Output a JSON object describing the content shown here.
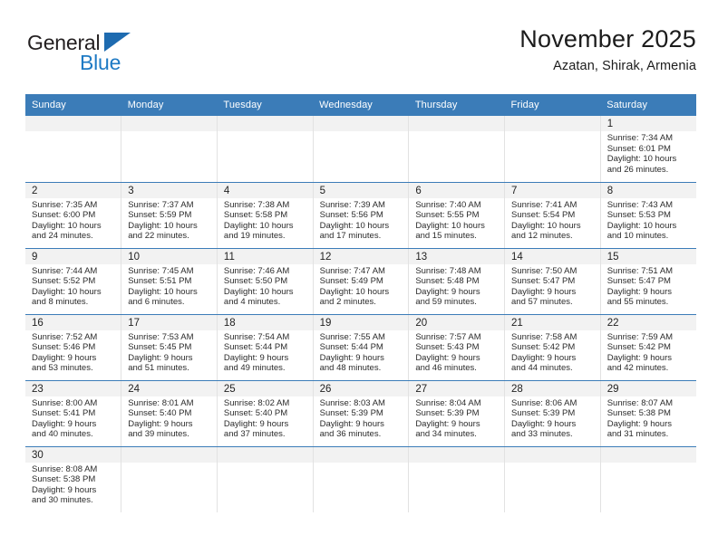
{
  "brand": {
    "name_part1": "General",
    "name_part2": "Blue",
    "triangle_color": "#1e6bb0",
    "blue_color": "#1e7ac4"
  },
  "header": {
    "title": "November 2025",
    "subtitle": "Azatan, Shirak, Armenia"
  },
  "theme": {
    "header_blue": "#3b7cb8",
    "daynum_bg": "#f2f2f2",
    "row_divider": "#3b7cb8",
    "cell_divider": "#e2e2e2"
  },
  "weekdays": [
    "Sunday",
    "Monday",
    "Tuesday",
    "Wednesday",
    "Thursday",
    "Friday",
    "Saturday"
  ],
  "labels": {
    "sunrise": "Sunrise:",
    "sunset": "Sunset:",
    "daylight": "Daylight:"
  },
  "weeks": [
    [
      {
        "day": "",
        "empty": true
      },
      {
        "day": "",
        "empty": true
      },
      {
        "day": "",
        "empty": true
      },
      {
        "day": "",
        "empty": true
      },
      {
        "day": "",
        "empty": true
      },
      {
        "day": "",
        "empty": true
      },
      {
        "day": "1",
        "sunrise": "Sunrise: 7:34 AM",
        "sunset": "Sunset: 6:01 PM",
        "daylight1": "Daylight: 10 hours",
        "daylight2": "and 26 minutes."
      }
    ],
    [
      {
        "day": "2",
        "sunrise": "Sunrise: 7:35 AM",
        "sunset": "Sunset: 6:00 PM",
        "daylight1": "Daylight: 10 hours",
        "daylight2": "and 24 minutes."
      },
      {
        "day": "3",
        "sunrise": "Sunrise: 7:37 AM",
        "sunset": "Sunset: 5:59 PM",
        "daylight1": "Daylight: 10 hours",
        "daylight2": "and 22 minutes."
      },
      {
        "day": "4",
        "sunrise": "Sunrise: 7:38 AM",
        "sunset": "Sunset: 5:58 PM",
        "daylight1": "Daylight: 10 hours",
        "daylight2": "and 19 minutes."
      },
      {
        "day": "5",
        "sunrise": "Sunrise: 7:39 AM",
        "sunset": "Sunset: 5:56 PM",
        "daylight1": "Daylight: 10 hours",
        "daylight2": "and 17 minutes."
      },
      {
        "day": "6",
        "sunrise": "Sunrise: 7:40 AM",
        "sunset": "Sunset: 5:55 PM",
        "daylight1": "Daylight: 10 hours",
        "daylight2": "and 15 minutes."
      },
      {
        "day": "7",
        "sunrise": "Sunrise: 7:41 AM",
        "sunset": "Sunset: 5:54 PM",
        "daylight1": "Daylight: 10 hours",
        "daylight2": "and 12 minutes."
      },
      {
        "day": "8",
        "sunrise": "Sunrise: 7:43 AM",
        "sunset": "Sunset: 5:53 PM",
        "daylight1": "Daylight: 10 hours",
        "daylight2": "and 10 minutes."
      }
    ],
    [
      {
        "day": "9",
        "sunrise": "Sunrise: 7:44 AM",
        "sunset": "Sunset: 5:52 PM",
        "daylight1": "Daylight: 10 hours",
        "daylight2": "and 8 minutes."
      },
      {
        "day": "10",
        "sunrise": "Sunrise: 7:45 AM",
        "sunset": "Sunset: 5:51 PM",
        "daylight1": "Daylight: 10 hours",
        "daylight2": "and 6 minutes."
      },
      {
        "day": "11",
        "sunrise": "Sunrise: 7:46 AM",
        "sunset": "Sunset: 5:50 PM",
        "daylight1": "Daylight: 10 hours",
        "daylight2": "and 4 minutes."
      },
      {
        "day": "12",
        "sunrise": "Sunrise: 7:47 AM",
        "sunset": "Sunset: 5:49 PM",
        "daylight1": "Daylight: 10 hours",
        "daylight2": "and 2 minutes."
      },
      {
        "day": "13",
        "sunrise": "Sunrise: 7:48 AM",
        "sunset": "Sunset: 5:48 PM",
        "daylight1": "Daylight: 9 hours",
        "daylight2": "and 59 minutes."
      },
      {
        "day": "14",
        "sunrise": "Sunrise: 7:50 AM",
        "sunset": "Sunset: 5:47 PM",
        "daylight1": "Daylight: 9 hours",
        "daylight2": "and 57 minutes."
      },
      {
        "day": "15",
        "sunrise": "Sunrise: 7:51 AM",
        "sunset": "Sunset: 5:47 PM",
        "daylight1": "Daylight: 9 hours",
        "daylight2": "and 55 minutes."
      }
    ],
    [
      {
        "day": "16",
        "sunrise": "Sunrise: 7:52 AM",
        "sunset": "Sunset: 5:46 PM",
        "daylight1": "Daylight: 9 hours",
        "daylight2": "and 53 minutes."
      },
      {
        "day": "17",
        "sunrise": "Sunrise: 7:53 AM",
        "sunset": "Sunset: 5:45 PM",
        "daylight1": "Daylight: 9 hours",
        "daylight2": "and 51 minutes."
      },
      {
        "day": "18",
        "sunrise": "Sunrise: 7:54 AM",
        "sunset": "Sunset: 5:44 PM",
        "daylight1": "Daylight: 9 hours",
        "daylight2": "and 49 minutes."
      },
      {
        "day": "19",
        "sunrise": "Sunrise: 7:55 AM",
        "sunset": "Sunset: 5:44 PM",
        "daylight1": "Daylight: 9 hours",
        "daylight2": "and 48 minutes."
      },
      {
        "day": "20",
        "sunrise": "Sunrise: 7:57 AM",
        "sunset": "Sunset: 5:43 PM",
        "daylight1": "Daylight: 9 hours",
        "daylight2": "and 46 minutes."
      },
      {
        "day": "21",
        "sunrise": "Sunrise: 7:58 AM",
        "sunset": "Sunset: 5:42 PM",
        "daylight1": "Daylight: 9 hours",
        "daylight2": "and 44 minutes."
      },
      {
        "day": "22",
        "sunrise": "Sunrise: 7:59 AM",
        "sunset": "Sunset: 5:42 PM",
        "daylight1": "Daylight: 9 hours",
        "daylight2": "and 42 minutes."
      }
    ],
    [
      {
        "day": "23",
        "sunrise": "Sunrise: 8:00 AM",
        "sunset": "Sunset: 5:41 PM",
        "daylight1": "Daylight: 9 hours",
        "daylight2": "and 40 minutes."
      },
      {
        "day": "24",
        "sunrise": "Sunrise: 8:01 AM",
        "sunset": "Sunset: 5:40 PM",
        "daylight1": "Daylight: 9 hours",
        "daylight2": "and 39 minutes."
      },
      {
        "day": "25",
        "sunrise": "Sunrise: 8:02 AM",
        "sunset": "Sunset: 5:40 PM",
        "daylight1": "Daylight: 9 hours",
        "daylight2": "and 37 minutes."
      },
      {
        "day": "26",
        "sunrise": "Sunrise: 8:03 AM",
        "sunset": "Sunset: 5:39 PM",
        "daylight1": "Daylight: 9 hours",
        "daylight2": "and 36 minutes."
      },
      {
        "day": "27",
        "sunrise": "Sunrise: 8:04 AM",
        "sunset": "Sunset: 5:39 PM",
        "daylight1": "Daylight: 9 hours",
        "daylight2": "and 34 minutes."
      },
      {
        "day": "28",
        "sunrise": "Sunrise: 8:06 AM",
        "sunset": "Sunset: 5:39 PM",
        "daylight1": "Daylight: 9 hours",
        "daylight2": "and 33 minutes."
      },
      {
        "day": "29",
        "sunrise": "Sunrise: 8:07 AM",
        "sunset": "Sunset: 5:38 PM",
        "daylight1": "Daylight: 9 hours",
        "daylight2": "and 31 minutes."
      }
    ],
    [
      {
        "day": "30",
        "sunrise": "Sunrise: 8:08 AM",
        "sunset": "Sunset: 5:38 PM",
        "daylight1": "Daylight: 9 hours",
        "daylight2": "and 30 minutes."
      },
      {
        "day": "",
        "empty": true
      },
      {
        "day": "",
        "empty": true
      },
      {
        "day": "",
        "empty": true
      },
      {
        "day": "",
        "empty": true
      },
      {
        "day": "",
        "empty": true
      },
      {
        "day": "",
        "empty": true
      }
    ]
  ]
}
